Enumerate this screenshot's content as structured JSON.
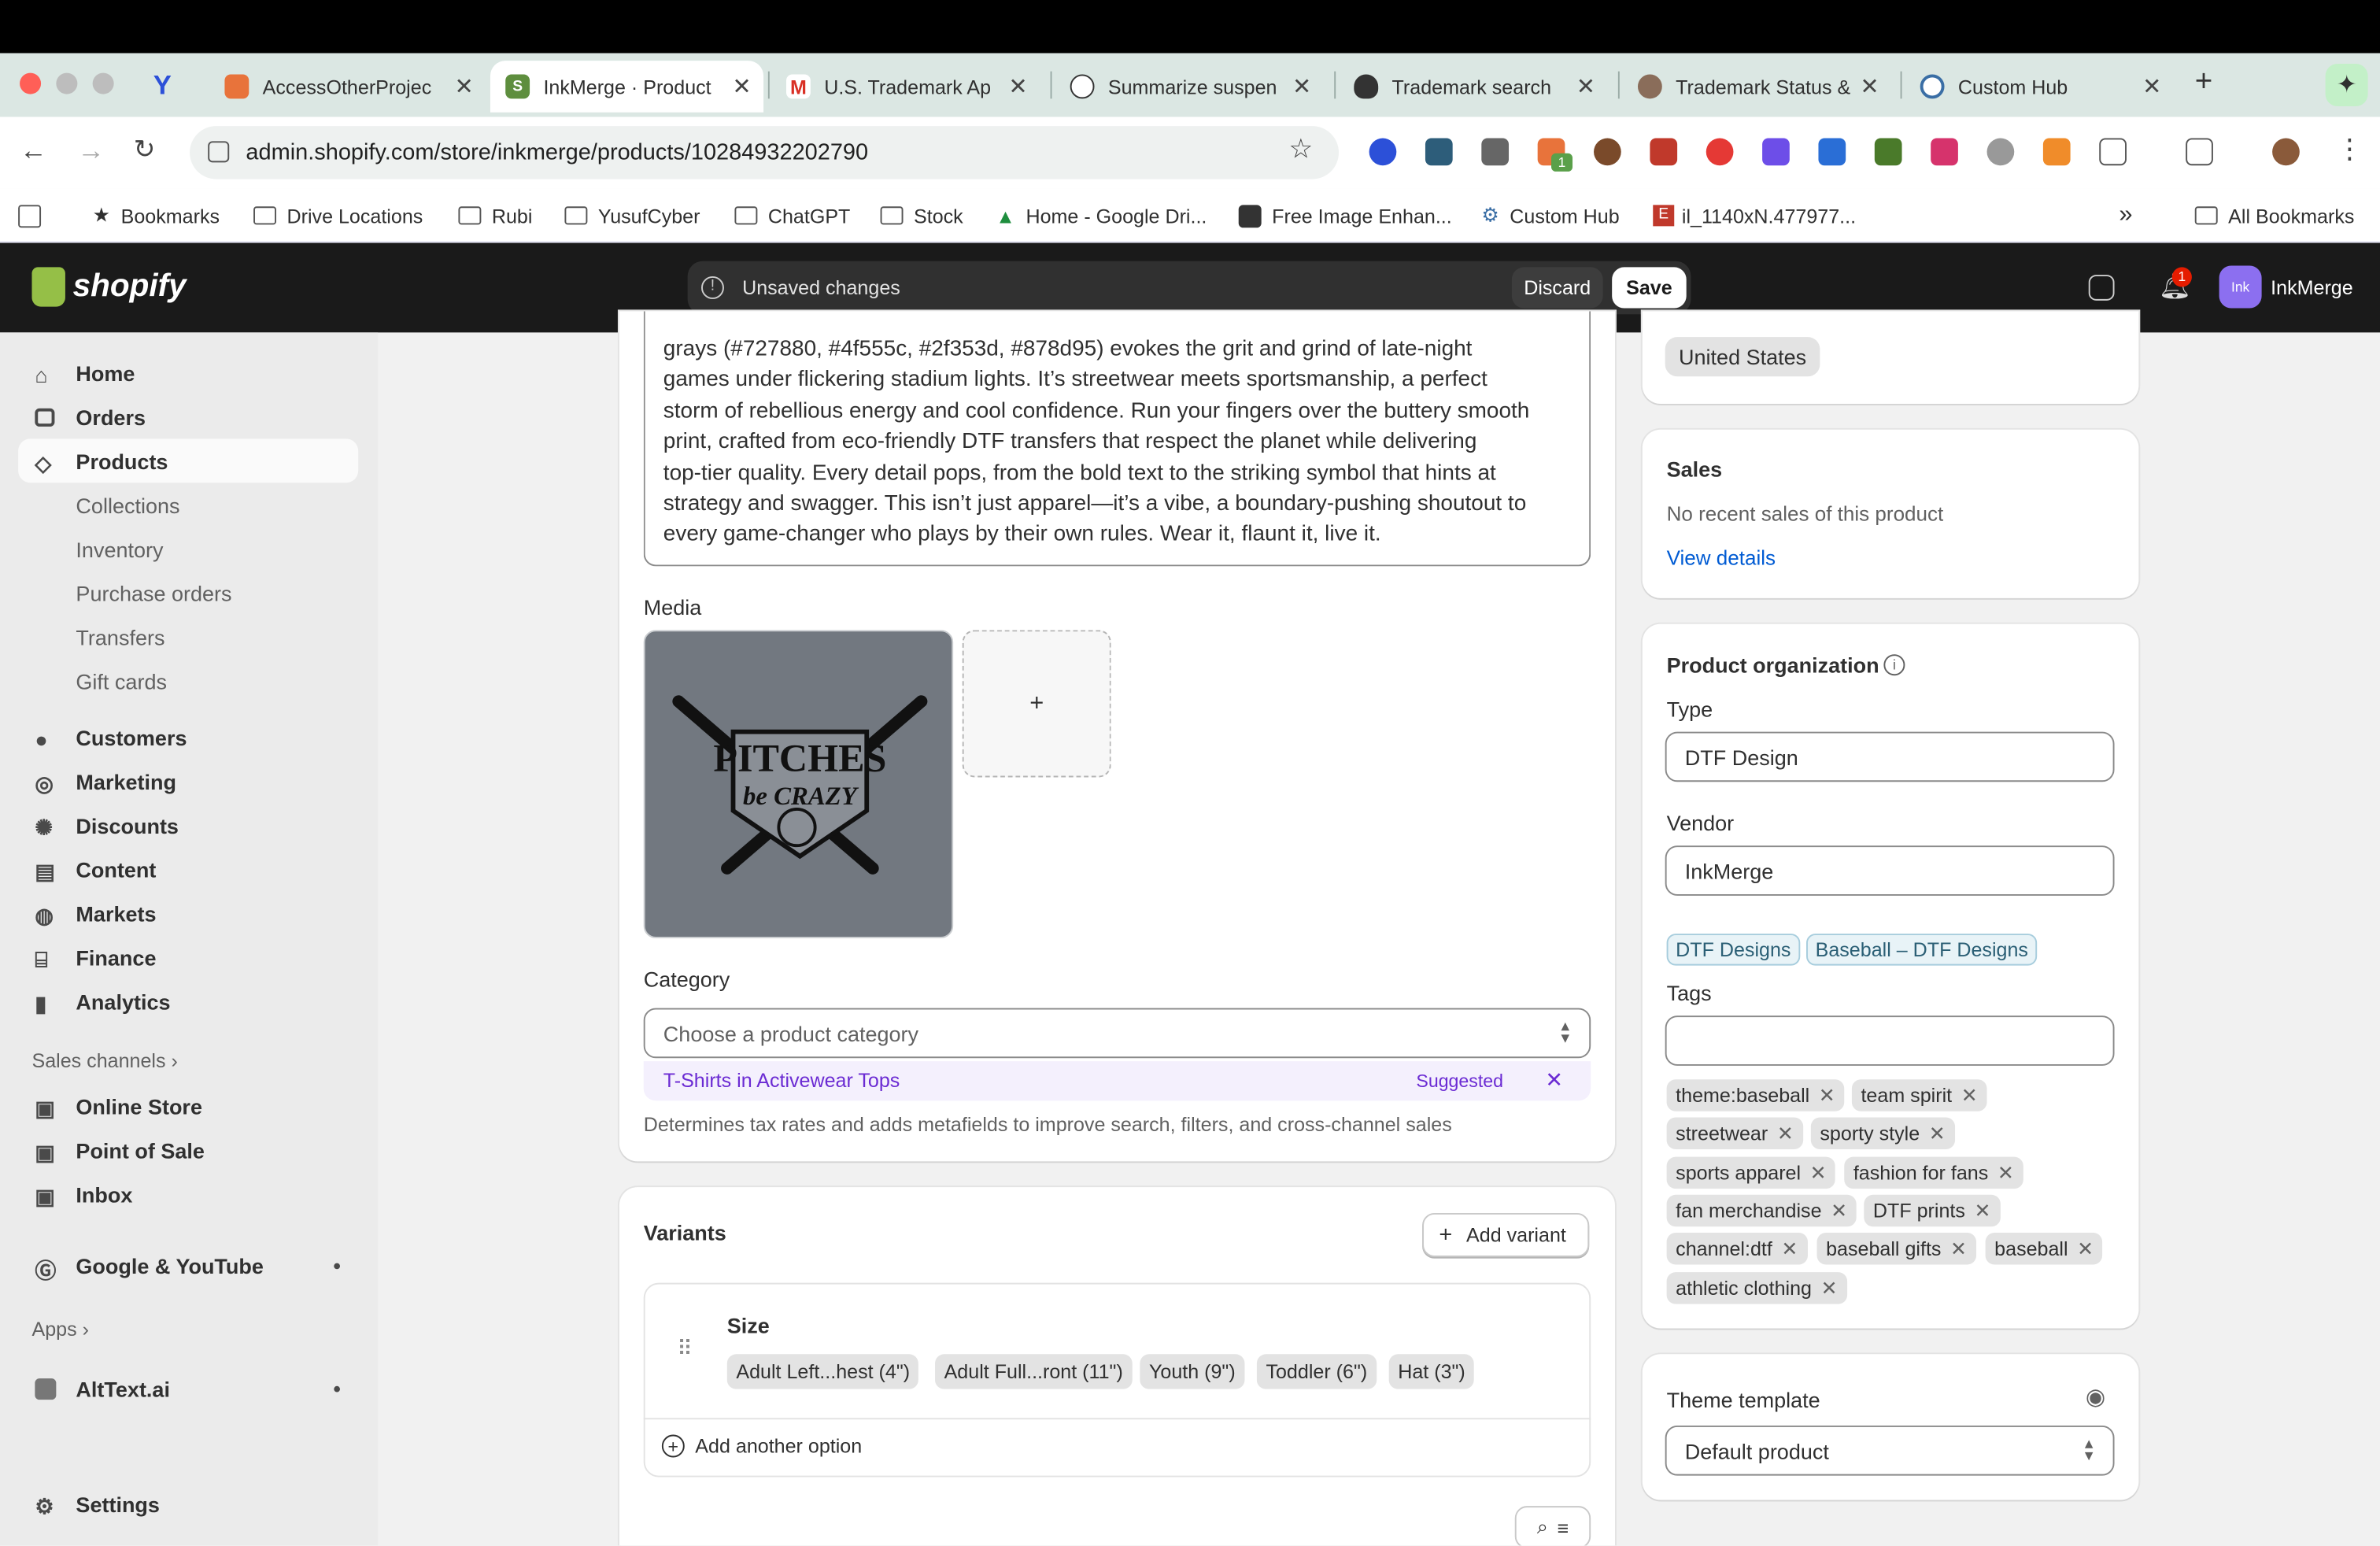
{
  "browser": {
    "tabs": [
      {
        "title": "AccessOtherProjec"
      },
      {
        "title": "InkMerge · Product"
      },
      {
        "title": "U.S. Trademark Ap"
      },
      {
        "title": "Summarize suspen"
      },
      {
        "title": "Trademark search"
      },
      {
        "title": "Trademark Status &"
      },
      {
        "title": "Custom Hub"
      }
    ],
    "url": "admin.shopify.com/store/inkmerge/products/10284932202790",
    "extension_badge": "1",
    "bookmarks": [
      "Bookmarks",
      "Drive Locations",
      "Rubi",
      "YusufCyber",
      "ChatGPT",
      "Stock",
      "Home - Google Dri...",
      "Free Image Enhan...",
      "Custom Hub",
      "il_1140xN.477977..."
    ],
    "all_bookmarks": "All Bookmarks",
    "overflow": "»"
  },
  "header": {
    "logo": "shopify",
    "unsaved": "Unsaved changes",
    "discard": "Discard",
    "save": "Save",
    "notif_count": "1",
    "store_avatar": "Ink",
    "store_name": "InkMerge"
  },
  "sidebar": {
    "home": "Home",
    "orders": "Orders",
    "products": "Products",
    "collections": "Collections",
    "inventory": "Inventory",
    "purchase_orders": "Purchase orders",
    "transfers": "Transfers",
    "gift_cards": "Gift cards",
    "customers": "Customers",
    "marketing": "Marketing",
    "discounts": "Discounts",
    "content": "Content",
    "markets": "Markets",
    "finance": "Finance",
    "analytics": "Analytics",
    "sales_channels": "Sales channels",
    "online_store": "Online Store",
    "pos": "Point of Sale",
    "inbox": "Inbox",
    "google": "Google & YouTube",
    "apps": "Apps",
    "alttext": "AltText.ai",
    "settings": "Settings"
  },
  "description": {
    "lines": [
      "grays (#727880, #4f555c, #2f353d, #878d95) evokes the grit and grind of late-night",
      "games under flickering stadium lights. It’s streetwear meets sportsmanship, a perfect",
      "storm of rebellious energy and cool confidence. Run your fingers over the buttery smooth",
      "print, crafted from eco-friendly DTF transfers that respect the planet while delivering",
      "top-tier quality. Every detail pops, from the bold text to the striking symbol that hints at",
      "strategy and swagger. This isn’t just apparel—it’s a vibe, a boundary-pushing shoutout to",
      "every game-changer who plays by their own rules. Wear it, flaunt it, live it."
    ]
  },
  "media": {
    "label": "Media",
    "image_text_1": "PITCHES",
    "image_text_2": "be CRAZY",
    "add": "+"
  },
  "category": {
    "label": "Category",
    "placeholder": "Choose a product category",
    "suggestion": "T-Shirts in Activewear Tops",
    "suggested_label": "Suggested",
    "help": "Determines tax rates and adds metafields to improve search, filters, and cross-channel sales"
  },
  "variants": {
    "title": "Variants",
    "add_variant": "Add variant",
    "option_name": "Size",
    "values": [
      "Adult Left...hest (4\")",
      "Adult Full...ront (11\")",
      "Youth (9\")",
      "Toddler (6\")",
      "Hat (3\")"
    ],
    "add_option": "Add another option"
  },
  "right": {
    "market": "United States",
    "sales_title": "Sales",
    "sales_text": "No recent sales of this product",
    "view_details": "View details",
    "org_title": "Product organization",
    "type_label": "Type",
    "type_value": "DTF Design",
    "vendor_label": "Vendor",
    "vendor_value": "InkMerge",
    "collections": [
      "DTF Designs",
      "Baseball – DTF Designs"
    ],
    "tags_label": "Tags",
    "tags": [
      "theme:baseball",
      "team spirit",
      "streetwear",
      "sporty style",
      "sports apparel",
      "fashion for fans",
      "fan merchandise",
      "DTF prints",
      "channel:dtf",
      "baseball gifts",
      "baseball",
      "athletic clothing"
    ],
    "theme_title": "Theme template",
    "theme_value": "Default product"
  },
  "colors": {
    "accent_link": "#005bd3",
    "suggest_purple": "#6b2bd3",
    "header_bg": "#1a1a1a",
    "media_gray": "#727880"
  }
}
